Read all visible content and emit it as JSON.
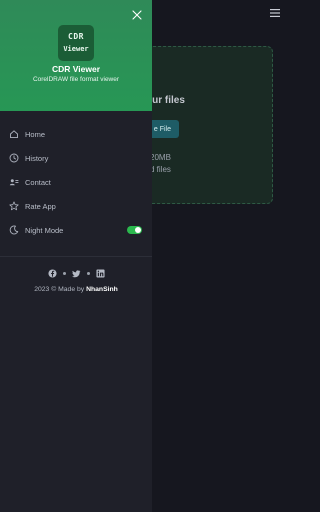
{
  "background": {
    "upload_title": "our files",
    "choose_label": "e File",
    "size_hint": "20MB",
    "files_hint": "d files"
  },
  "drawer": {
    "app_logo_line1": "CDR",
    "app_logo_line2": "Viewer",
    "app_title": "CDR Viewer",
    "app_subtitle": "CorelDRAW file format viewer",
    "items": [
      {
        "label": "Home",
        "icon": "home-icon"
      },
      {
        "label": "History",
        "icon": "clock-icon"
      },
      {
        "label": "Contact",
        "icon": "contact-card-icon"
      },
      {
        "label": "Rate App",
        "icon": "star-icon"
      },
      {
        "label": "Night Mode",
        "icon": "moon-icon",
        "toggle_on": true
      }
    ],
    "social": [
      "facebook-icon",
      "twitter-icon",
      "linkedin-icon"
    ],
    "footer_prefix": "2023 © Made by",
    "footer_author": "NhanSinh"
  },
  "colors": {
    "accent": "#2bb84e",
    "header_green": "#2f8a58",
    "drawer_bg": "#1f2029",
    "app_bg": "#16171f"
  }
}
